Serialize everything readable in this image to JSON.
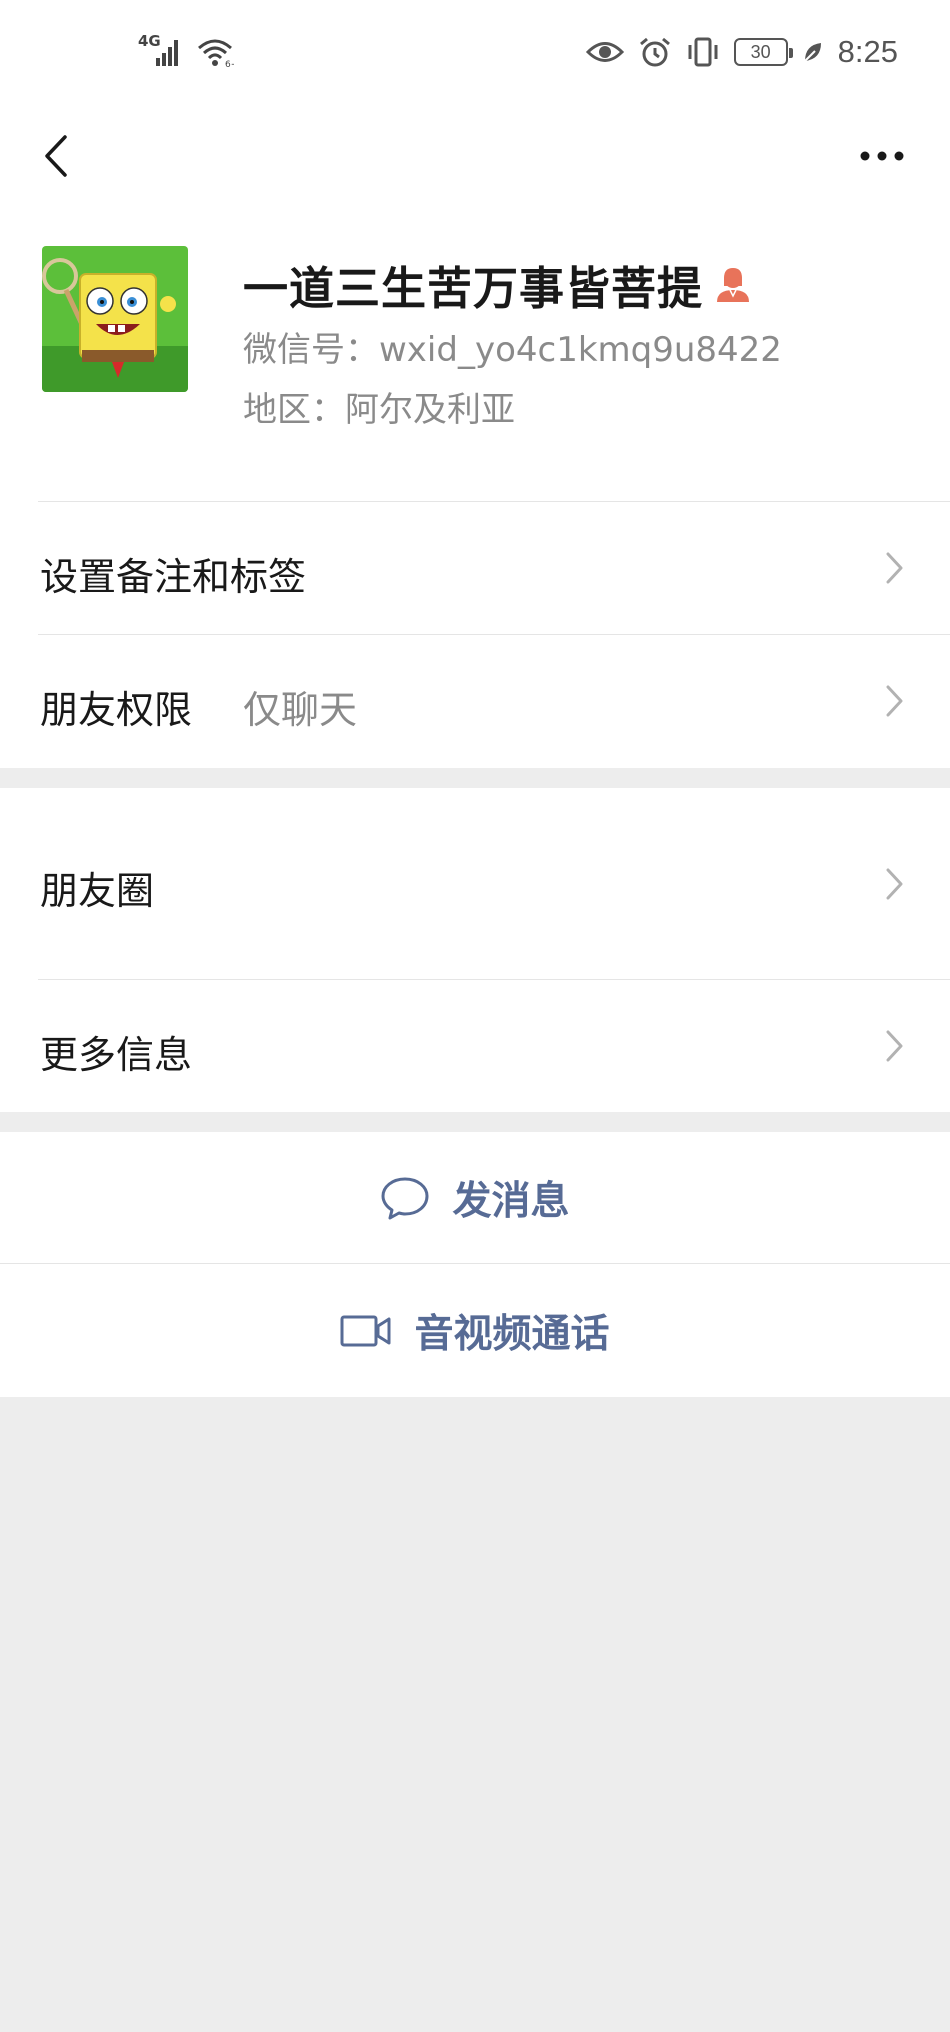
{
  "status_bar": {
    "network": "4G",
    "battery": "30",
    "time": "8:25",
    "icons": [
      "signal-icon",
      "wifi-icon",
      "eye-icon",
      "alarm-icon",
      "vibrate-icon",
      "battery-icon",
      "leaf-icon"
    ]
  },
  "nav": {
    "back_icon": "chevron-left-icon",
    "more_icon": "more-dots-icon"
  },
  "profile": {
    "nickname": "一道三生苦万事皆菩提",
    "gender_icon": "female-user-icon",
    "wechat_id": "微信号：wxid_yo4c1kmq9u8422",
    "region": "地区：阿尔及利亚",
    "avatar": "avatar-image"
  },
  "menu": {
    "remark_tags": "设置备注和标签",
    "friend_permission_label": "朋友权限",
    "friend_permission_value": "仅聊天",
    "moments": "朋友圈",
    "more_info": "更多信息"
  },
  "actions": {
    "send_message": "发消息",
    "video_call": "音视频通话"
  },
  "colors": {
    "background": "#ededed",
    "card": "#ffffff",
    "link": "#576b95",
    "secondary_text": "#8a8a8a",
    "gender_female": "#e8735a"
  }
}
